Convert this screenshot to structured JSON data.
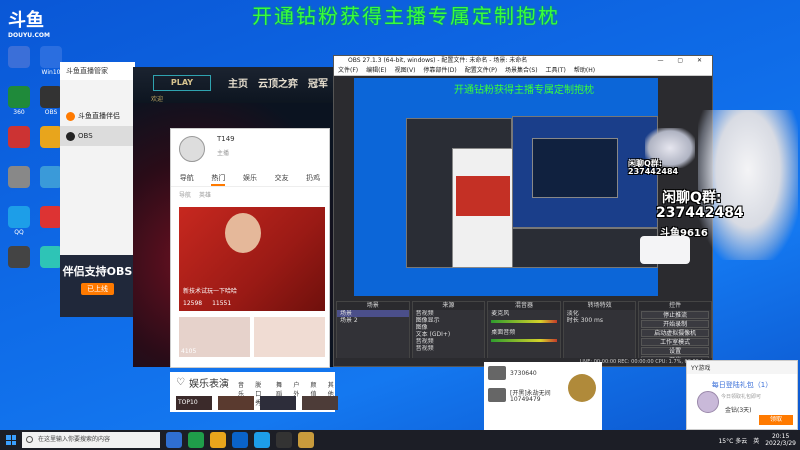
{
  "banner": "开通钻粉获得主播专属定制抱枕",
  "douyu_logo": {
    "name": "斗鱼",
    "sub": "DOUYU.COM"
  },
  "desktop_icons": [
    {
      "label": "",
      "color": "#3b6fd8"
    },
    {
      "label": "Win10",
      "color": "#2a6ee0"
    },
    {
      "label": "360",
      "color": "#1f8a3a"
    },
    {
      "label": "OBS",
      "color": "#333"
    },
    {
      "label": "",
      "color": "#c33"
    },
    {
      "label": "",
      "color": "#e8a51c"
    },
    {
      "label": "",
      "color": "#888"
    },
    {
      "label": "",
      "color": "#3a9ad9"
    },
    {
      "label": "QQ",
      "color": "#1d9ee8"
    },
    {
      "label": "",
      "color": "#d33"
    },
    {
      "label": "",
      "color": "#444"
    },
    {
      "label": "",
      "color": "#2ec4b6"
    }
  ],
  "manager": {
    "title": "斗鱼直播管家",
    "items": [
      {
        "label": "斗鱼直播伴侣",
        "color": "#ff7a00"
      },
      {
        "label": "OBS",
        "color": "#222"
      }
    ],
    "promo_title": "伴侣支持OBS",
    "promo_button": "已上线"
  },
  "lol": {
    "play": "PLAY",
    "tabs": [
      "主页",
      "云顶之弈",
      "冠军"
    ],
    "subtabs": [
      "欢迎"
    ]
  },
  "streamer_card": {
    "name": "T149",
    "sub": "主播",
    "tabs": [
      "导航",
      "热门",
      "娱乐",
      "交友",
      "扔鸡"
    ],
    "subtabs": [
      "导航",
      "英雄"
    ],
    "video_caption": "新技术试玩一下哈哈",
    "video_views": "12598",
    "video_likes": "11551",
    "thumb1": "4105",
    "thumb2": ""
  },
  "entertainment": {
    "title": "娱乐表演",
    "tabs": [
      "音乐",
      "脱口秀",
      "舞蹈",
      "户外",
      "颜值",
      "颜值",
      "其他"
    ],
    "row": [
      "TOP10",
      "",
      "",
      ""
    ]
  },
  "obs": {
    "title": "OBS 27.1.3 (64-bit, windows) - 配置文件: 未命名 - 场景: 未命名",
    "menu": [
      "文件(F)",
      "编辑(E)",
      "视图(V)",
      "停靠部件(D)",
      "配置文件(P)",
      "场景集合(S)",
      "工具(T)",
      "帮助(H)"
    ],
    "mini_banner": "开通钻粉获得主播专属定制抱枕",
    "docks": {
      "scenes": {
        "header": "场景",
        "items": [
          "场景",
          "场景 2"
        ]
      },
      "sources": {
        "header": "来源",
        "items": [
          "音视频",
          "图像显示",
          "图像",
          "文本 (GDI+)",
          "音视频",
          "音视频"
        ]
      },
      "mixer": {
        "header": "混音器",
        "items": [
          "麦克风",
          "桌面音频"
        ]
      },
      "transitions": {
        "header": "转场特效",
        "items": [
          "淡化",
          "时长 300 ms"
        ]
      },
      "controls": {
        "header": "控件",
        "items": [
          "停止推流",
          "开始录制",
          "启动虚拟摄像机",
          "工作室模式",
          "设置",
          "退出"
        ]
      }
    },
    "status": "LIVE: 00:00:00  REC: 00:00:00  CPU: 1.7%, 60.00 fps"
  },
  "qq_sticker": {
    "line1": "闲聊Q群:",
    "line2": "237442484",
    "line3": "斗鱼9616",
    "small1": "闲聊Q群:",
    "small2": "237442484"
  },
  "dy_list": {
    "row1": "3730640",
    "row2": "[开黑]永劫无间",
    "row3": "10749479"
  },
  "notification": {
    "title": "YY游戏",
    "main": "每日登陆礼包（1）",
    "sub": "今日领取礼包即可",
    "gift": "金钻(3天)",
    "button": "领取"
  },
  "taskbar": {
    "search_placeholder": "在这里输入你要搜索的内容",
    "temp": "15°C 多云",
    "lang": "英",
    "time": "20:15",
    "date": "2022/3/29"
  }
}
